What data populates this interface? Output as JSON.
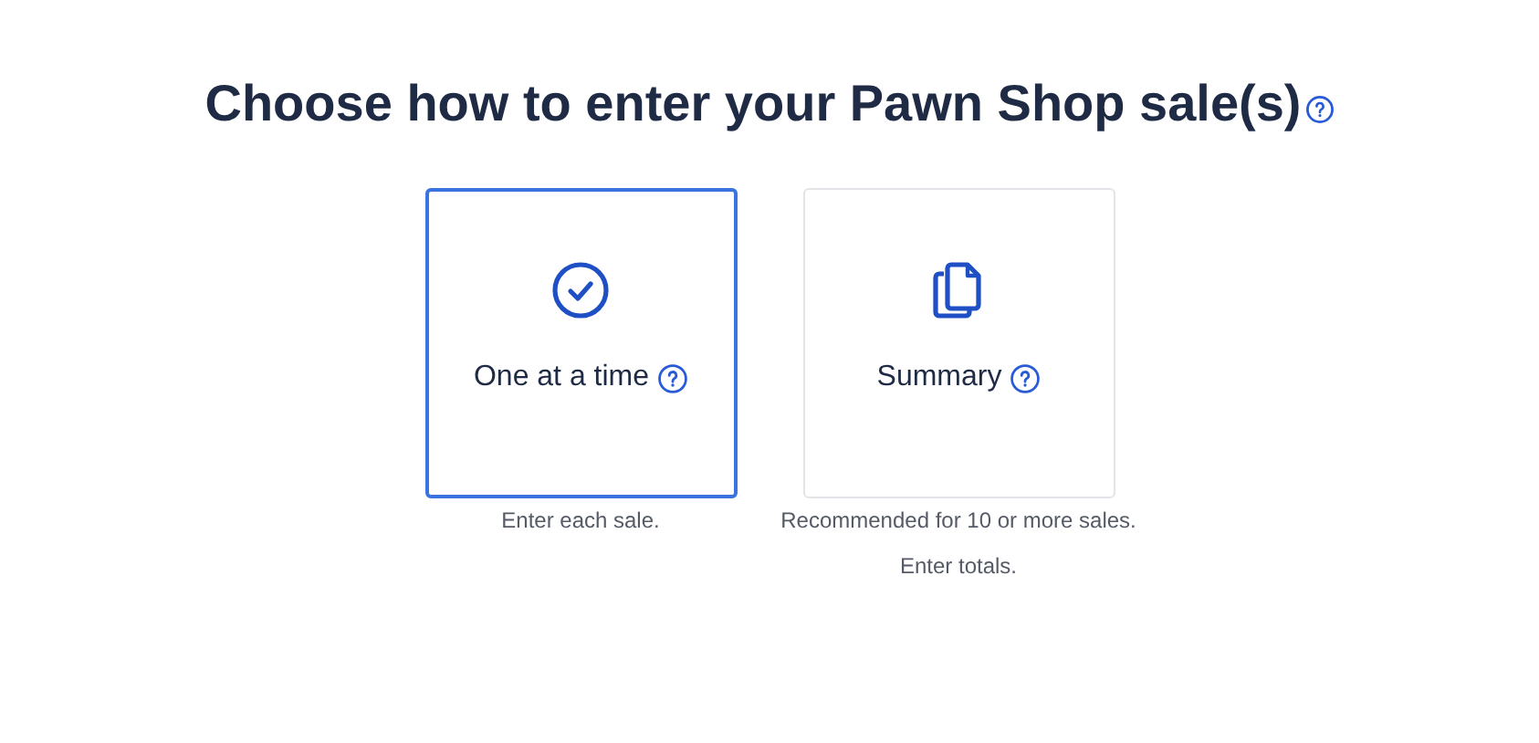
{
  "heading": "Choose how to enter your Pawn Shop sale(s)",
  "options": [
    {
      "kind": "check",
      "label": "One at a time",
      "selected": true,
      "descriptions": [
        "Enter each sale."
      ]
    },
    {
      "kind": "documents",
      "label": "Summary",
      "selected": false,
      "descriptions": [
        "Recommended for 10 or more sales.",
        "Enter totals."
      ]
    }
  ]
}
